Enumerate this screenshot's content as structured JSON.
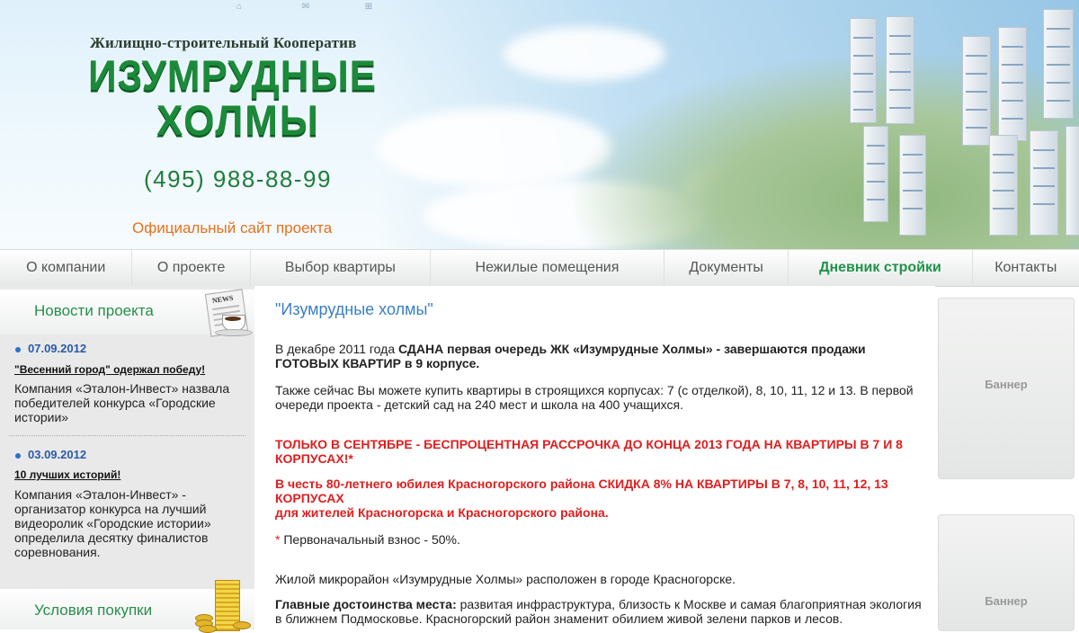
{
  "header": {
    "coop_name": "Жилищно-строительный Кооператив",
    "logo_line1": "ИЗУМРУДНЫЕ",
    "logo_line2": "ХОЛМЫ",
    "phone": "(495) 988-88-99",
    "tagline": "Официальный сайт проекта",
    "top_icons": [
      "home-icon",
      "mail-icon",
      "sitemap-icon"
    ]
  },
  "nav": {
    "items": [
      {
        "label": "О компании"
      },
      {
        "label": "О проекте"
      },
      {
        "label": "Выбор квартиры"
      },
      {
        "label": "Нежилые помещения"
      },
      {
        "label": "Документы"
      },
      {
        "label": "Дневник стройки"
      },
      {
        "label": "Контакты"
      }
    ],
    "active": "Дневник стройки"
  },
  "sidebar": {
    "news_title": "Новости проекта",
    "news": [
      {
        "date": "07.09.2012",
        "headline": "\"Весенний город\" одержал победу!",
        "text": "Компания «Эталон-Инвест» назвала победителей конкурса «Городские истории»"
      },
      {
        "date": "03.09.2012",
        "headline": "10 лучших историй!",
        "text": "Компания «Эталон-Инвест» - организатор конкурса на лучший видеоролик «Городские истории» определила десятку финалистов соревнования."
      }
    ],
    "purchase_title": "Условия покупки"
  },
  "main": {
    "title": "\"Изумрудные холмы\"",
    "p1_prefix": "В декабре 2011 года ",
    "p1_bold": "СДАНА первая очередь ЖК «Изумрудные Холмы» - завершаются продажи ГОТОВЫХ КВАРТИР в 9 корпусе.",
    "p2": "Также сейчас Вы можете купить квартиры в строящихся корпусах: 7 (с отделкой), 8, 10, 11, 12 и 13. В первой очереди проекта - детский сад на 240 мест и школа на 400 учащихся.",
    "promo1": "ТОЛЬКО В СЕНТЯБРЕ - БЕСПРОЦЕНТНАЯ РАССРОЧКА ДО КОНЦА 2013 ГОДА НА КВАРТИРЫ В 7 И 8 КОРПУСАХ!*",
    "promo2_line1": "В честь 80-летнего юбилея Красногорского района СКИДКА 8% НА КВАРТИРЫ В 7, 8, 10, 11, 12, 13 КОРПУСАХ",
    "promo2_line2": "для жителей Красногорска и Красногорского района.",
    "footnote_star": "* ",
    "footnote": "Первоначальный взнос - 50%.",
    "p3": "Жилой микрорайон «Изумрудные Холмы» расположен в городе Красногорске.",
    "p4_label": "Главные достоинства места:",
    "p4_text": " развитая инфраструктура, близость к Москве и самая благоприятная экология в ближнем Подмосковье. Красногорский район знаменит обилием живой зелени парков и лесов."
  },
  "banners": [
    "Баннер",
    "Баннер"
  ],
  "colors": {
    "accent_green": "#21924a",
    "title_blue": "#3a7fc4",
    "promo_red": "#e01e1e",
    "tagline_orange": "#e8701c",
    "date_blue": "#2a5aa8"
  }
}
